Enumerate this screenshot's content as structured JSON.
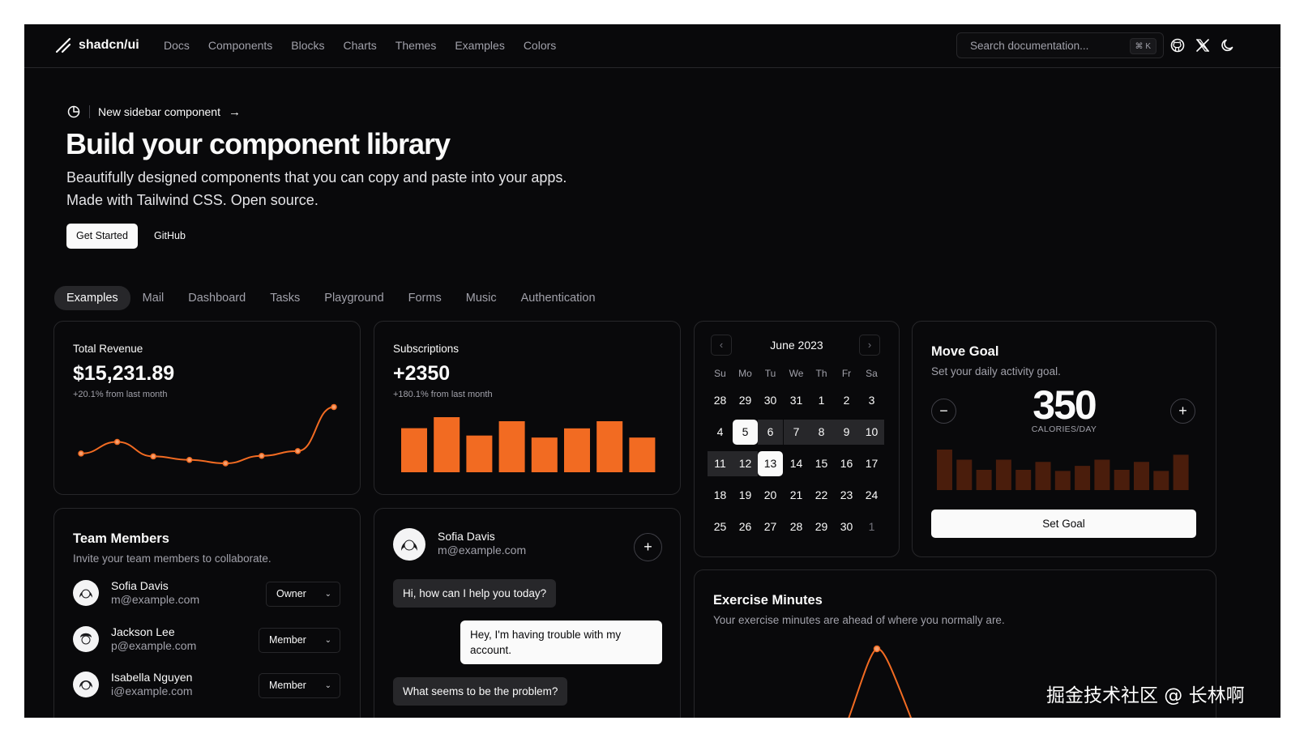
{
  "header": {
    "brand": "shadcn/ui",
    "nav": [
      "Docs",
      "Components",
      "Blocks",
      "Charts",
      "Themes",
      "Examples",
      "Colors"
    ],
    "search_placeholder": "Search documentation...",
    "search_shortcut": "⌘ K",
    "icons": [
      "github-icon",
      "x-twitter-icon",
      "moon-icon"
    ]
  },
  "hero": {
    "announcement": "New sidebar component",
    "title": "Build your component library",
    "subtitle_line1": "Beautifully designed components that you can copy and paste into your apps.",
    "subtitle_line2": "Made with Tailwind CSS. Open source.",
    "primary_button": "Get Started",
    "secondary_button": "GitHub"
  },
  "tabs": [
    "Examples",
    "Mail",
    "Dashboard",
    "Tasks",
    "Playground",
    "Forms",
    "Music",
    "Authentication"
  ],
  "active_tab": "Examples",
  "revenue": {
    "label": "Total Revenue",
    "value": "$15,231.89",
    "change": "+20.1% from last month",
    "chart_data": {
      "type": "line",
      "values": [
        10400,
        14405,
        9400,
        8200,
        7000,
        9600,
        11244,
        26475
      ]
    }
  },
  "subscriptions": {
    "label": "Subscriptions",
    "value": "+2350",
    "change": "+180.1% from last month",
    "chart_data": {
      "type": "bar",
      "values": [
        240,
        300,
        200,
        278,
        189,
        239,
        278,
        189
      ]
    }
  },
  "calendar": {
    "month": "June 2023",
    "weekdays": [
      "Su",
      "Mo",
      "Tu",
      "We",
      "Th",
      "Fr",
      "Sa"
    ],
    "weeks": [
      [
        "28",
        "29",
        "30",
        "31",
        "1",
        "2",
        "3"
      ],
      [
        "4",
        "5",
        "6",
        "7",
        "8",
        "9",
        "10"
      ],
      [
        "11",
        "12",
        "13",
        "14",
        "15",
        "16",
        "17"
      ],
      [
        "18",
        "19",
        "20",
        "21",
        "22",
        "23",
        "24"
      ],
      [
        "25",
        "26",
        "27",
        "28",
        "29",
        "30",
        "1"
      ]
    ],
    "range_start": "5",
    "range_end": "13"
  },
  "move_goal": {
    "title": "Move Goal",
    "description": "Set your daily activity goal.",
    "value": "350",
    "unit": "CALORIES/DAY",
    "button": "Set Goal",
    "chart_data": {
      "type": "bar",
      "values": [
        400,
        300,
        200,
        300,
        200,
        278,
        189,
        239,
        300,
        200,
        278,
        189,
        349
      ]
    }
  },
  "team": {
    "title": "Team Members",
    "description": "Invite your team members to collaborate.",
    "members": [
      {
        "name": "Sofia Davis",
        "email": "m@example.com",
        "role": "Owner"
      },
      {
        "name": "Jackson Lee",
        "email": "p@example.com",
        "role": "Member"
      },
      {
        "name": "Isabella Nguyen",
        "email": "i@example.com",
        "role": "Member"
      }
    ]
  },
  "chat": {
    "name": "Sofia Davis",
    "email": "m@example.com",
    "messages": [
      {
        "from": "them",
        "text": "Hi, how can I help you today?"
      },
      {
        "from": "me",
        "text": "Hey, I'm having trouble with my account."
      },
      {
        "from": "them",
        "text": "What seems to be the problem?"
      }
    ]
  },
  "exercise": {
    "title": "Exercise Minutes",
    "description": "Your exercise minutes are ahead of where you normally are."
  },
  "watermark": "掘金技术社区 @ 长林啊",
  "colors": {
    "accent": "#f26b22",
    "accent_dim": "#4a1d0c",
    "background": "#09090b",
    "border": "#27272a"
  }
}
